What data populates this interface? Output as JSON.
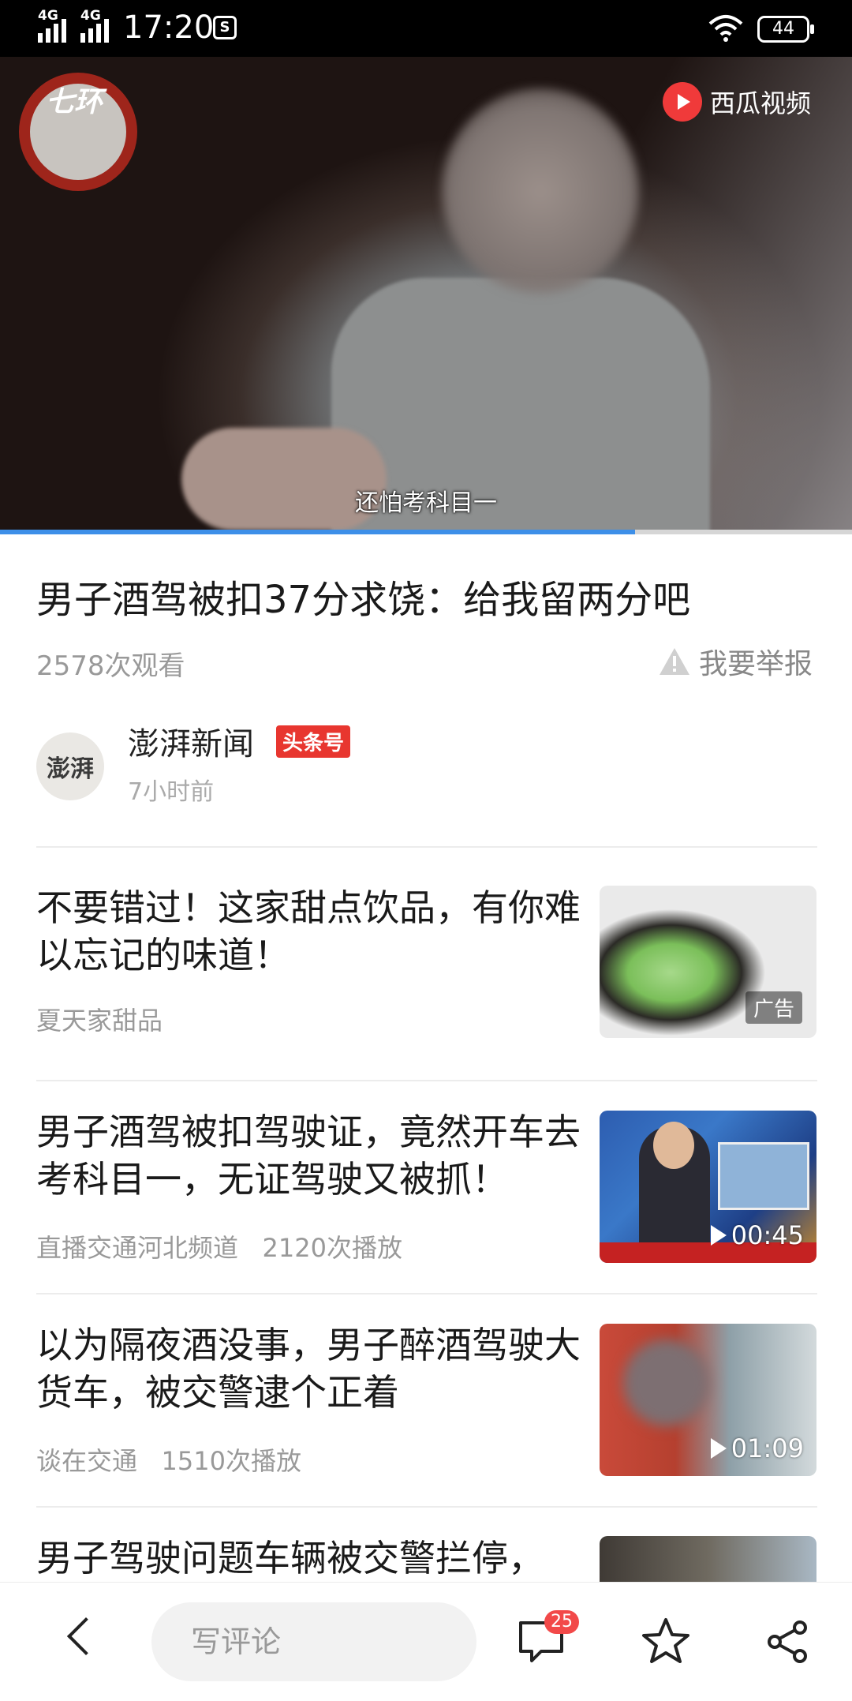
{
  "status_bar": {
    "network1": "4G",
    "network2": "4G",
    "time": "17:20",
    "sim_icon": "S",
    "battery": "44"
  },
  "video": {
    "watermark_left": "七环",
    "watermark_right": "西瓜视频",
    "subtitle": "还怕考科目一",
    "progress_fraction": 0.745
  },
  "article": {
    "title": "男子酒驾被扣37分求饶：给我留两分吧",
    "views": "2578次观看",
    "report": "我要举报"
  },
  "author": {
    "avatar_text": "澎湃",
    "name": "澎湃新闻",
    "badge": "头条号",
    "time": "7小时前"
  },
  "feed": [
    {
      "title": "不要错过！这家甜点饮品，有你难以忘记的味道！",
      "source": "夏天家甜品",
      "plays": "",
      "tag": "广告",
      "duration": ""
    },
    {
      "title": "男子酒驾被扣驾驶证，竟然开车去考科目一，无证驾驶又被抓！",
      "source": "直播交通河北频道",
      "plays": "2120次播放",
      "tag": "",
      "duration": "00:45"
    },
    {
      "title": "以为隔夜酒没事，男子醉酒驾驶大货车，被交警逮个正着",
      "source": "谈在交通",
      "plays": "1510次播放",
      "tag": "",
      "duration": "01:09"
    },
    {
      "title": "男子驾驶问题车辆被交警拦停，",
      "source": "",
      "plays": "",
      "tag": "",
      "duration": ""
    }
  ],
  "bottom_bar": {
    "comment_placeholder": "写评论",
    "comment_count": "25"
  },
  "icons": {
    "back": "chevron-left-icon",
    "comment": "comment-icon",
    "favorite": "star-icon",
    "share": "share-icon",
    "report": "warning-icon",
    "video_logo": "xigua-logo"
  },
  "colors": {
    "badge_red": "#e8362f",
    "progress_blue": "#3d8fe8",
    "comment_badge": "#f24949"
  }
}
